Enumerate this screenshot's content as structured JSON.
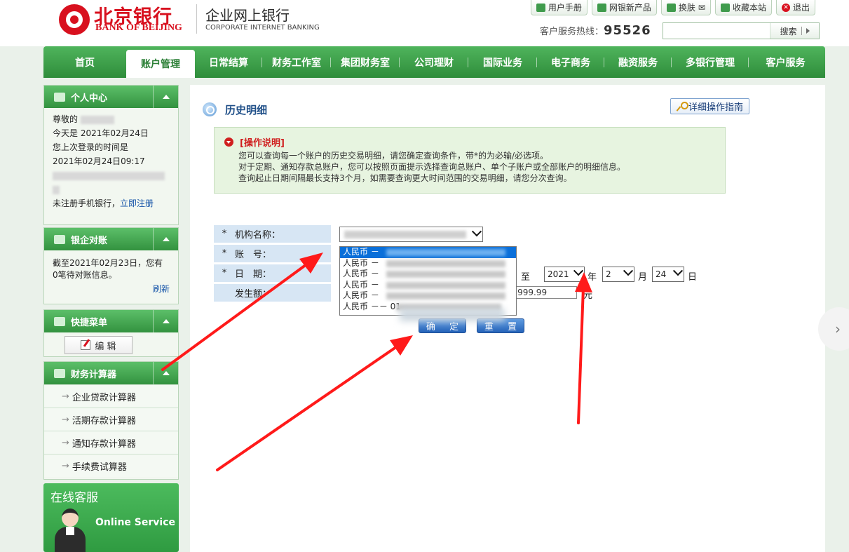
{
  "header": {
    "bank_name_cn": "北京银行",
    "bank_name_en": "BANK OF BEIJING",
    "product_cn": "企业网上银行",
    "product_en": "CORPORATE INTERNET BANKING",
    "toplinks": [
      "用户手册",
      "网银新产品",
      "换肤",
      "收藏本站",
      "退出"
    ],
    "hotline_label": "客户服务热线：",
    "hotline_number": "95526",
    "search_placeholder": "",
    "search_label": "搜索"
  },
  "nav": {
    "items": [
      "首页",
      "账户管理",
      "日常结算",
      "财务工作室",
      "集团财务室",
      "公司理财",
      "国际业务",
      "电子商务",
      "融资服务",
      "多银行管理",
      "客户服务"
    ],
    "active": "账户管理"
  },
  "sidebar": {
    "personal": {
      "title": "个人中心",
      "greeting": "尊敬的",
      "today_label": "今天是",
      "today_date": "2021年02月24日",
      "last_login_label": "您上次登录的时间是",
      "last_login_time": "2021年02月24日09:17",
      "mobile_text": "未注册手机银行，",
      "register_link": "立即注册"
    },
    "reconciliation": {
      "title": "银企对账",
      "line1": "截至2021年02月23日，您有",
      "line2": "0笔待对账信息。",
      "refresh": "刷新"
    },
    "quick_menu": {
      "title": "快捷菜单",
      "edit_label": "编 辑"
    },
    "calculator": {
      "title": "财务计算器",
      "items": [
        "企业贷款计算器",
        "活期存款计算器",
        "通知存款计算器",
        "手续费试算器"
      ]
    },
    "online_service": {
      "title": "在线客服",
      "subtitle": "Online Service"
    }
  },
  "main": {
    "title": "历史明细",
    "guide_button": "详细操作指南",
    "notice": {
      "title": "[操作说明]",
      "lines": [
        "您可以查询每一个账户的历史交易明细，请您确定查询条件，带*的为必输/必选项。",
        "对于定期、通知存款总账户，您可以按照页面提示选择查询总账户、单个子账户或全部账户的明细信息。",
        "查询起止日期间隔最长支持3个月，如需要查询更大时间范围的交易明细，请您分次查询。"
      ]
    },
    "form": {
      "org_label": "机构名称：",
      "account_label": "账　号：",
      "date_label": "日　期：",
      "amount_label": "发生额：",
      "required_mark": "*",
      "account_options": [
        "人民币 －",
        "人民币 －",
        "人民币 －",
        "人民币 －",
        "人民币 －",
        "人民币 －－ 01"
      ],
      "date_to_label": "至",
      "year_value": "2021",
      "year_unit": "年",
      "month_value": "2",
      "month_unit": "月",
      "day_value": "24",
      "day_unit": "日",
      "amount_max": "99,999.99",
      "amount_unit": "元",
      "confirm_button": "确 定",
      "reset_button": "重 置"
    }
  },
  "colors": {
    "brand_red": "#d8101e",
    "nav_green": "#3a9a46",
    "annotation_red": "#ff1a1a",
    "selected_blue": "#0a6fd9"
  }
}
